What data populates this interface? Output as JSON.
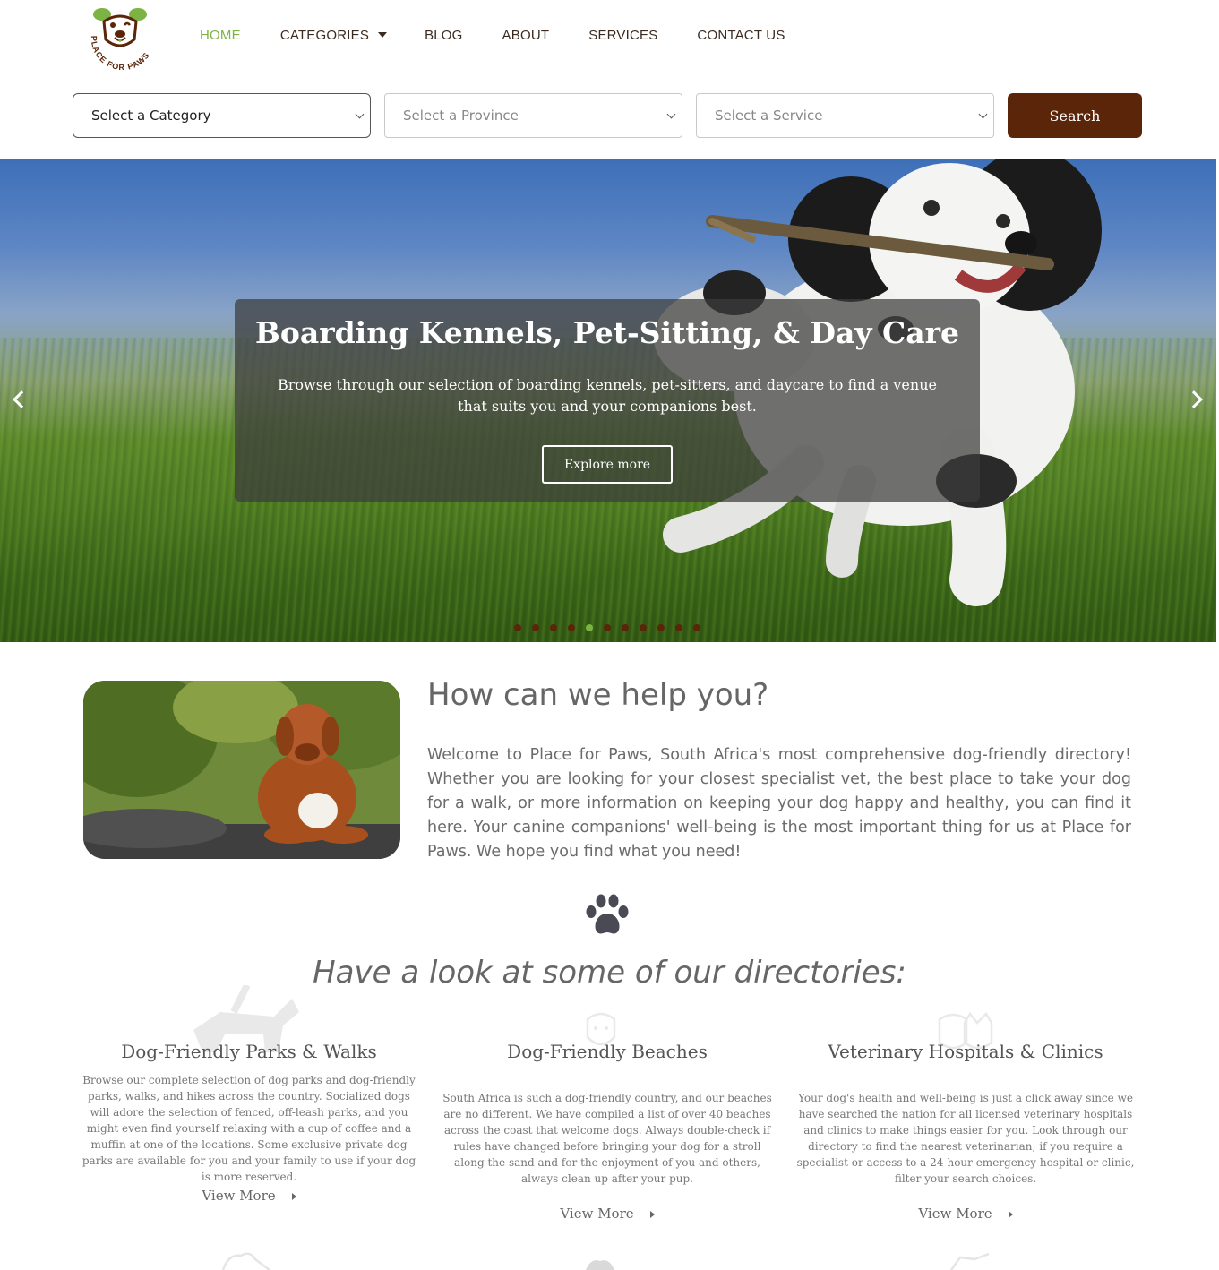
{
  "brand": {
    "logo_text": "PLACE FOR PAWS",
    "accent": "#7cb342",
    "dark": "#5a2508"
  },
  "nav": {
    "items": [
      {
        "label": "HOME"
      },
      {
        "label": "CATEGORIES"
      },
      {
        "label": "BLOG"
      },
      {
        "label": "ABOUT"
      },
      {
        "label": "SERVICES"
      },
      {
        "label": "CONTACT US"
      }
    ]
  },
  "search": {
    "category_value": "Select a Category",
    "province_value": "Select a Province",
    "service_value": "Select a Service",
    "button_label": "Search"
  },
  "hero": {
    "title": "Boarding Kennels, Pet-Sitting, & Day Care",
    "text": "Browse through our selection of boarding kennels, pet-sitters, and daycare to find a venue that suits you and your companions best.",
    "button_label": "Explore more",
    "slide_count": 11,
    "active_slide": 4
  },
  "help": {
    "title": "How can we help you?",
    "text": "Welcome to Place for Paws, South Africa's most comprehensive dog-friendly directory! Whether you are looking for your closest specialist vet, the best place to take your dog for a walk, or more information on keeping your dog happy and healthy, you can find it here. Your canine companions' well-being is the most important thing for us at Place for Paws. We hope you find what you need!"
  },
  "directories": {
    "heading": "Have a look at some of our directories:",
    "items": [
      {
        "title": "Dog-Friendly Parks & Walks",
        "text": "Browse our complete selection of dog parks and dog-friendly parks, walks, and hikes across the country. Socialized dogs will adore the selection of fenced, off-leash parks, and you might even find yourself relaxing with a cup of coffee and a muffin at one of the locations. Some exclusive private dog parks are available for you and your family to use if your dog is more reserved.",
        "link": "View More",
        "icon": "service-dog-icon"
      },
      {
        "title": "Dog-Friendly Beaches",
        "text": "South Africa is such a dog-friendly country, and our beaches are no different. We have compiled a list of over 40 beaches across the coast that welcome dogs. Always double-check if rules have changed before bringing your dog for a stroll along the sand and for the enjoyment of you and others, always clean up after your pup.",
        "link": "View More",
        "icon": "dog-head-icon"
      },
      {
        "title": "Veterinary Hospitals & Clinics",
        "text": "Your dog's health and well-being is just a click away since we have searched the nation for all licensed veterinary hospitals and clinics to make things easier for you. Look through our directory to find the nearest veterinarian; if you require a specialist or access to a 24-hour emergency hospital or clinic, filter your search choices.",
        "link": "View More",
        "icon": "dog-cat-icon"
      }
    ]
  }
}
